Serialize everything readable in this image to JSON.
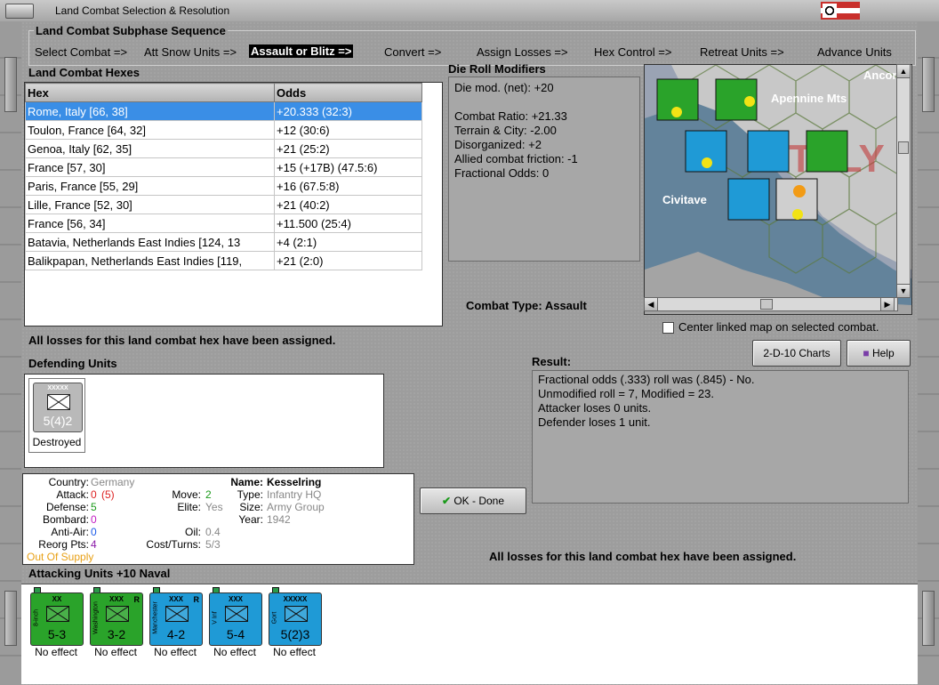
{
  "window": {
    "title": "Land Combat Selection & Resolution"
  },
  "sequence": {
    "label": "Land Combat Subphase Sequence",
    "items": [
      {
        "label": "Select Combat =>",
        "active": false
      },
      {
        "label": "Att Snow Units =>",
        "active": false
      },
      {
        "label": "Assault or Blitz =>",
        "active": true
      },
      {
        "label": "Convert =>",
        "active": false
      },
      {
        "label": "Assign Losses =>",
        "active": false
      },
      {
        "label": "Hex Control =>",
        "active": false
      },
      {
        "label": "Retreat Units =>",
        "active": false
      },
      {
        "label": "Advance Units",
        "active": false
      }
    ]
  },
  "hexes": {
    "label": "Land Combat Hexes",
    "columns": [
      "Hex",
      "Odds"
    ],
    "rows": [
      {
        "hex": "Rome, Italy [66, 38]",
        "odds": "+20.333 (32:3)",
        "selected": true
      },
      {
        "hex": "Toulon, France [64, 32]",
        "odds": "+12 (30:6)"
      },
      {
        "hex": "Genoa, Italy [62, 35]",
        "odds": "+21 (25:2)"
      },
      {
        "hex": "France [57, 30]",
        "odds": "+15 (+17B) (47.5:6)"
      },
      {
        "hex": "Paris, France [55, 29]",
        "odds": "+16 (67.5:8)"
      },
      {
        "hex": "Lille, France [52, 30]",
        "odds": "+21 (40:2)"
      },
      {
        "hex": "France [56, 34]",
        "odds": "+11.500 (25:4)"
      },
      {
        "hex": "Batavia, Netherlands East Indies [124, 13",
        "odds": "+4 (2:1)"
      },
      {
        "hex": "Balikpapan, Netherlands East Indies [119,",
        "odds": "+21 (2:0)"
      }
    ]
  },
  "die_roll": {
    "label": "Die Roll Modifiers",
    "lines": [
      "Die mod. (net): +20",
      "",
      "Combat Ratio: +21.33",
      "Terrain & City: -2.00",
      "Disorganized: +2",
      "Allied combat friction: -1",
      "Fractional Odds: 0"
    ]
  },
  "combat_type": "Combat Type:  Assault",
  "map": {
    "labels": [
      "Apennine Mts",
      "Ancona",
      "Civitave",
      "ITALY"
    ],
    "center_checkbox_label": "Center linked map on selected combat.",
    "center_checked": false
  },
  "losses_assigned_msg": "All losses for this land combat hex have been assigned.",
  "buttons": {
    "charts": "2-D-10 Charts",
    "help": "Help",
    "ok": "OK - Done"
  },
  "defending": {
    "label": "Defending Units",
    "units": [
      {
        "name": "Kesselring",
        "size": "XXXXX",
        "strength": "5(4)2",
        "status": "Destroyed",
        "color": "#b9b9b9"
      }
    ]
  },
  "unit_info": {
    "country_label": "Country:",
    "country": "Germany",
    "attack_label": "Attack:",
    "attack": "0",
    "attack_extra": "(5)",
    "defense_label": "Defense:",
    "defense": "5",
    "bombard_label": "Bombard:",
    "bombard": "0",
    "antiair_label": "Anti-Air:",
    "antiair": "0",
    "reorg_label": "Reorg Pts:",
    "reorg": "4",
    "supply": "Out Of Supply",
    "move_label": "Move:",
    "move": "2",
    "elite_label": "Elite:",
    "elite": "Yes",
    "oil_label": "Oil:",
    "oil": "0.4",
    "cost_label": "Cost/Turns:",
    "cost": "5/3",
    "name_label": "Name:",
    "name": "Kesselring",
    "type_label": "Type:",
    "type": "Infantry HQ",
    "size_label": "Size:",
    "size": "Army Group",
    "year_label": "Year:",
    "year": "1942"
  },
  "result": {
    "label": "Result:",
    "lines": [
      "Fractional odds (.333) roll was (.845)  - No.",
      "Unmodified roll = 7, Modified = 23.",
      "Attacker loses 0 units.",
      "Defender loses 1 unit."
    ]
  },
  "attacking": {
    "label": "Attacking Units +10 Naval",
    "units": [
      {
        "name": "8-inch",
        "size": "XX",
        "strength": "5-3",
        "status": "No effect",
        "color": "#2aa32a",
        "corner": ""
      },
      {
        "name": "Washington",
        "size": "XXX",
        "strength": "3-2",
        "status": "No effect",
        "color": "#2aa32a",
        "corner": "R"
      },
      {
        "name": "Manchester",
        "size": "XXX",
        "strength": "4-2",
        "status": "No effect",
        "color": "#1f9ad6",
        "corner": "R"
      },
      {
        "name": "V Inf",
        "size": "XXX",
        "strength": "5-4",
        "status": "No effect",
        "color": "#1f9ad6",
        "corner": ""
      },
      {
        "name": "Gort",
        "size": "XXXXX",
        "strength": "5(2)3",
        "status": "No effect",
        "color": "#1f9ad6",
        "corner": ""
      }
    ]
  }
}
